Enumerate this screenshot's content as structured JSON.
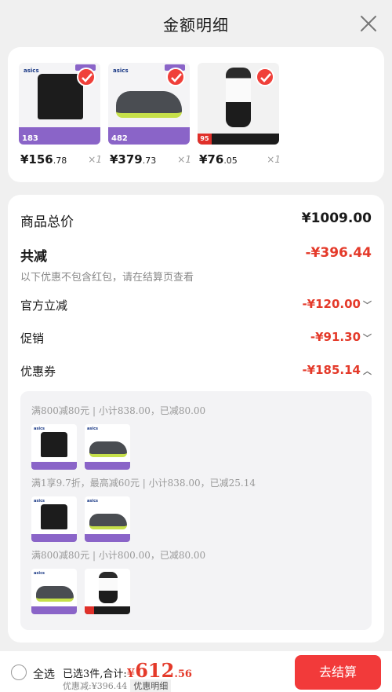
{
  "header": {
    "title": "金额明细"
  },
  "products": [
    {
      "brand": "asics",
      "badge": "183",
      "price_int": "¥156",
      "price_dec": ".78",
      "qty": "×1",
      "kind": "shirt"
    },
    {
      "brand": "asics",
      "badge": "482",
      "price_int": "¥379",
      "price_dec": ".73",
      "qty": "×1",
      "kind": "shoe"
    },
    {
      "brand": "",
      "badge": "95",
      "price_int": "¥76",
      "price_dec": ".05",
      "qty": "×1",
      "kind": "girl"
    }
  ],
  "detail": {
    "total_label": "商品总价",
    "total_value": "¥1009.00",
    "reduce_label": "共减",
    "reduce_value": "-¥396.44",
    "note": "以下优惠不包含红包，请在结算页查看",
    "official_label": "官方立减",
    "official_value": "-¥120.00",
    "promo_label": "促销",
    "promo_value": "-¥91.30",
    "coupon_label": "优惠券",
    "coupon_value": "-¥185.14"
  },
  "coupon_rules": [
    {
      "text": "满800减80元 | 小计838.00，已减80.00"
    },
    {
      "text": "满1享9.7折，最高减60元 | 小计838.00，已减25.14"
    },
    {
      "text": "满800减80元 | 小计800.00，已减80.00"
    }
  ],
  "mini_brand": "asics",
  "bottom": {
    "select_all": "全选",
    "selected_text": "已选3件,合计:",
    "total_cur": "¥",
    "total_int": "612",
    "total_dec": ".56",
    "discount_text": "优惠减:¥396.44",
    "detail_link": "优惠明细",
    "checkout": "去结算"
  },
  "colors": {
    "accent": "#f23a3a",
    "discount": "#e43a2a",
    "badge": "#8a64c8"
  }
}
